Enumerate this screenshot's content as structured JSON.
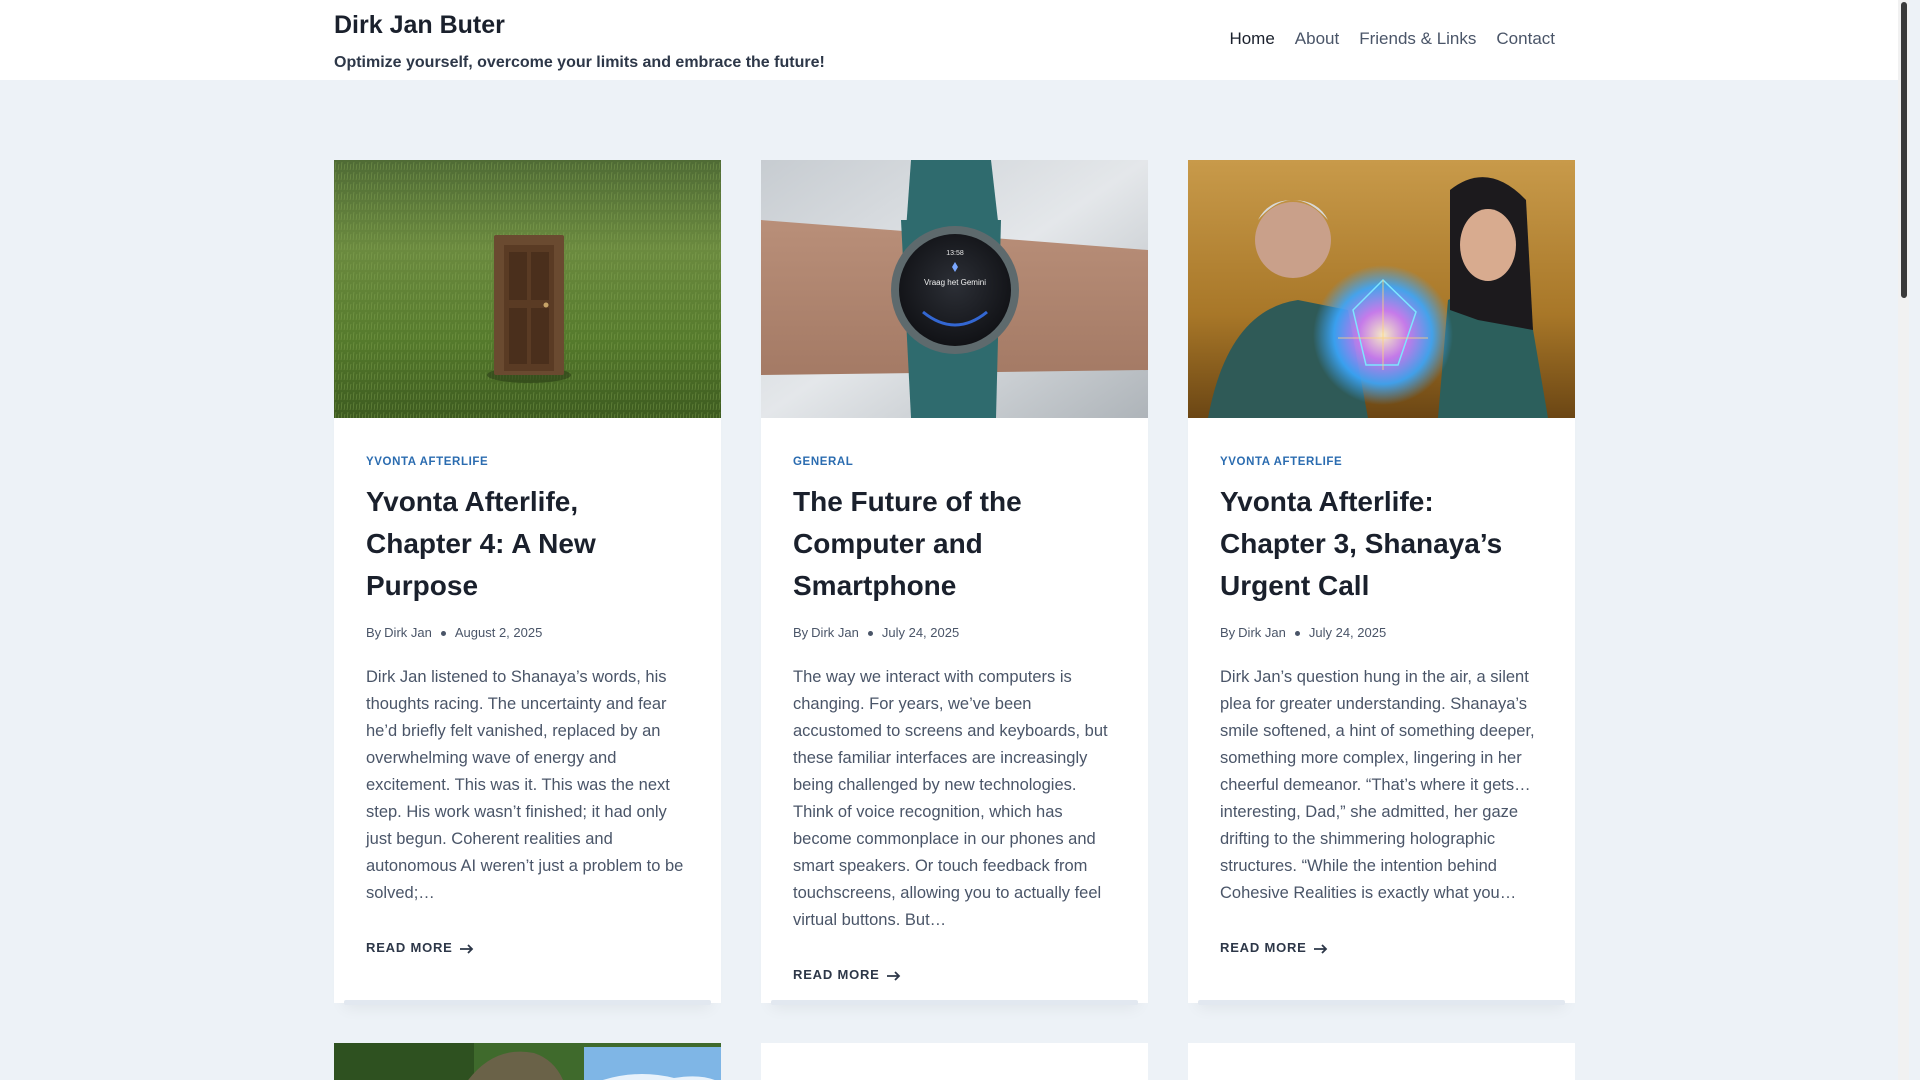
{
  "header": {
    "site_title": "Dirk Jan Buter",
    "tagline": "Optimize yourself, overcome your limits and embrace the future!",
    "nav": [
      {
        "label": "Home",
        "active": true
      },
      {
        "label": "About",
        "active": false
      },
      {
        "label": "Friends & Links",
        "active": false
      },
      {
        "label": "Contact",
        "active": false
      }
    ]
  },
  "posts": [
    {
      "category": "Yvonta Afterlife",
      "title": "Yvonta Afterlife, Chapter 4: A New Purpose",
      "by_label": "By",
      "author": "Dirk Jan",
      "date": "August 2, 2025",
      "excerpt": "Dirk Jan listened to Shanaya’s words, his thoughts racing. The uncertainty and fear he’d briefly felt vanished, replaced by an overwhelming wave of energy and excitement. This was it. This was the next step. His work wasn’t finished; it had only just begun. Coherent realities and autonomous AI weren’t just a problem to be solved;…",
      "read_more": "Read More",
      "image": "wooden-door-in-grass-field"
    },
    {
      "category": "General",
      "title": "The Future of the Computer and Smartphone",
      "by_label": "By",
      "author": "Dirk Jan",
      "date": "July 24, 2025",
      "excerpt": "The way we interact with computers is changing. For years, we’ve been accustomed to screens and keyboards, but these familiar interfaces are increasingly being challenged by new technologies. Think of voice recognition, which has become commonplace in our phones and smart speakers. Or touch feedback from touchscreens, allowing you to actually feel virtual buttons. But…",
      "read_more": "Read More",
      "image": "smartwatch-on-wrist",
      "watch_time": "13:58",
      "watch_text": "Vraag het Gemini"
    },
    {
      "category": "Yvonta Afterlife",
      "title": "Yvonta Afterlife: Chapter 3, Shanaya’s Urgent Call",
      "by_label": "By",
      "author": "Dirk Jan",
      "date": "July 24, 2025",
      "excerpt": "Dirk Jan’s question hung in the air, a silent plea for greater understanding. Shanaya’s smile softened, a hint of something deeper, something more complex, lingering in her cheerful demeanor. “That’s where it gets… interesting, Dad,” she admitted, her gaze drifting to the shimmering holographic structures. “While the intention behind Cohesive Realities is exactly what you…",
      "read_more": "Read More",
      "image": "man-and-woman-with-hologram"
    }
  ],
  "colors": {
    "background": "#edf2f7",
    "accent": "#2b6cb0",
    "heading": "#1a202c",
    "text": "#4a5568"
  }
}
